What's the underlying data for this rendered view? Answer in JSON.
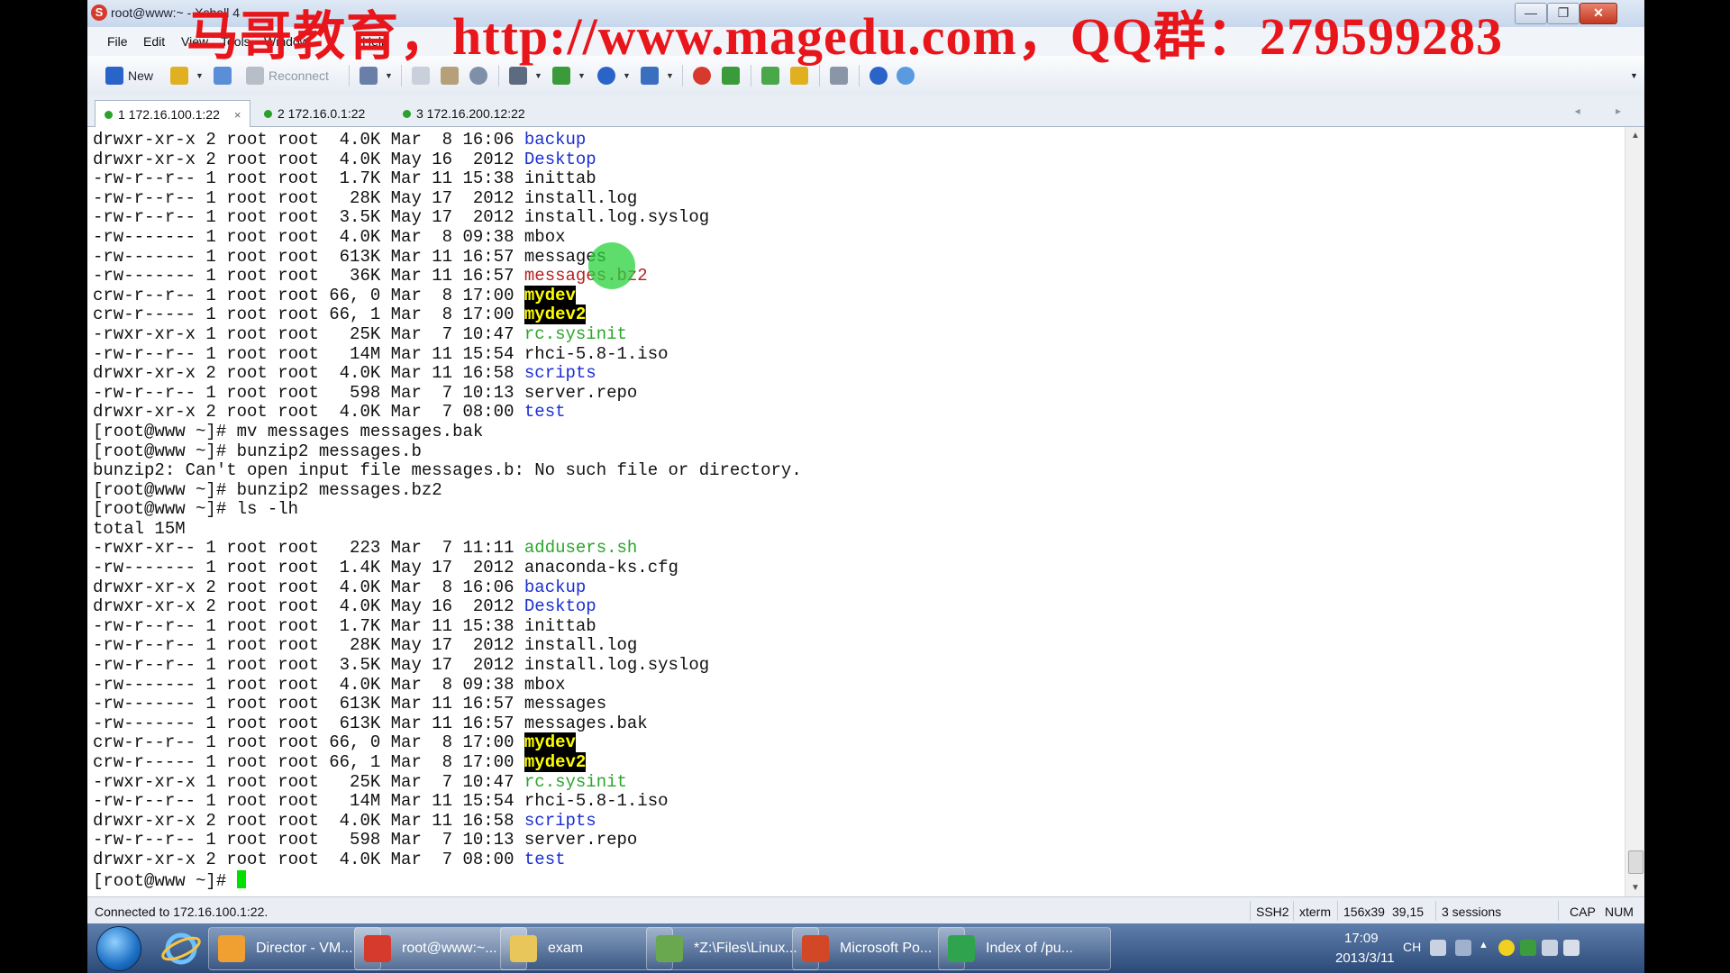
{
  "window": {
    "title": "root@www:~ - Xshell 4",
    "app_logo": "S",
    "controls": {
      "minimize": "—",
      "maximize": "❐",
      "close": "✕"
    }
  },
  "watermark": "马哥教育，http://www.magedu.com，QQ群：279599283",
  "menu": [
    "File",
    "Edit",
    "View",
    "Tools",
    "Window",
    "Help"
  ],
  "toolbar": {
    "new_label": "New",
    "reconnect_label": "Reconnect",
    "icons": [
      "new-session-icon",
      "open-folder-icon",
      "link-icon",
      "reconnect-icon",
      "properties-icon",
      "copy-icon",
      "paste-icon",
      "find-icon",
      "print-icon",
      "transfer-icon",
      "globe-icon",
      "font-icon",
      "xftp-icon",
      "script-icon",
      "layout-icon",
      "lock-icon",
      "keyboard-icon",
      "help-icon",
      "chat-icon"
    ],
    "colors": {
      "red": "#d63a2c",
      "green": "#3b9b3b",
      "blue": "#2a64c8",
      "yellow": "#e0b020",
      "gray": "#8a96a8"
    }
  },
  "tabs": [
    {
      "label": "1 172.16.100.1:22",
      "active": true,
      "close": "×"
    },
    {
      "label": "2 172.16.0.1:22",
      "active": false
    },
    {
      "label": "3 172.16.200.12:22",
      "active": false
    }
  ],
  "tab_arrows": "◂ ▸",
  "terminal": {
    "lines": [
      {
        "text": "drwxr-xr-x 2 root root  4.0K Mar  8 16:06 ",
        "name": "backup",
        "color": "blue"
      },
      {
        "text": "drwxr-xr-x 2 root root  4.0K May 16  2012 ",
        "name": "Desktop",
        "color": "blue"
      },
      {
        "text": "-rw-r--r-- 1 root root  1.7K Mar 11 15:38 ",
        "name": "inittab",
        "color": ""
      },
      {
        "text": "-rw-r--r-- 1 root root   28K May 17  2012 ",
        "name": "install.log",
        "color": ""
      },
      {
        "text": "-rw-r--r-- 1 root root  3.5K May 17  2012 ",
        "name": "install.log.syslog",
        "color": ""
      },
      {
        "text": "-rw------- 1 root root  4.0K Mar  8 09:38 ",
        "name": "mbox",
        "color": ""
      },
      {
        "text": "-rw------- 1 root root  613K Mar 11 16:57 ",
        "name": "messages",
        "color": ""
      },
      {
        "text": "-rw------- 1 root root   36K Mar 11 16:57 ",
        "name": "messages.bz2",
        "color": "red"
      },
      {
        "text": "crw-r--r-- 1 root root 66, 0 Mar  8 17:00 ",
        "name": "mydev",
        "color": "dev"
      },
      {
        "text": "crw-r----- 1 root root 66, 1 Mar  8 17:00 ",
        "name": "mydev2",
        "color": "dev"
      },
      {
        "text": "-rwxr-xr-x 1 root root   25K Mar  7 10:47 ",
        "name": "rc.sysinit",
        "color": "green"
      },
      {
        "text": "-rw-r--r-- 1 root root   14M Mar 11 15:54 ",
        "name": "rhci-5.8-1.iso",
        "color": ""
      },
      {
        "text": "drwxr-xr-x 2 root root  4.0K Mar 11 16:58 ",
        "name": "scripts",
        "color": "blue"
      },
      {
        "text": "-rw-r--r-- 1 root root   598 Mar  7 10:13 ",
        "name": "server.repo",
        "color": ""
      },
      {
        "text": "drwxr-xr-x 2 root root  4.0K Mar  7 08:00 ",
        "name": "test",
        "color": "blue"
      },
      {
        "text": "[root@www ~]# mv messages messages.bak",
        "name": "",
        "color": ""
      },
      {
        "text": "[root@www ~]# bunzip2 messages.b",
        "name": "",
        "color": ""
      },
      {
        "text": "bunzip2: Can't open input file messages.b: No such file or directory.",
        "name": "",
        "color": ""
      },
      {
        "text": "[root@www ~]# bunzip2 messages.bz2",
        "name": "",
        "color": ""
      },
      {
        "text": "[root@www ~]# ls -lh",
        "name": "",
        "color": ""
      },
      {
        "text": "total 15M",
        "name": "",
        "color": ""
      },
      {
        "text": "-rwxr-xr-- 1 root root   223 Mar  7 11:11 ",
        "name": "addusers.sh",
        "color": "green"
      },
      {
        "text": "-rw------- 1 root root  1.4K May 17  2012 ",
        "name": "anaconda-ks.cfg",
        "color": ""
      },
      {
        "text": "drwxr-xr-x 2 root root  4.0K Mar  8 16:06 ",
        "name": "backup",
        "color": "blue"
      },
      {
        "text": "drwxr-xr-x 2 root root  4.0K May 16  2012 ",
        "name": "Desktop",
        "color": "blue"
      },
      {
        "text": "-rw-r--r-- 1 root root  1.7K Mar 11 15:38 ",
        "name": "inittab",
        "color": ""
      },
      {
        "text": "-rw-r--r-- 1 root root   28K May 17  2012 ",
        "name": "install.log",
        "color": ""
      },
      {
        "text": "-rw-r--r-- 1 root root  3.5K May 17  2012 ",
        "name": "install.log.syslog",
        "color": ""
      },
      {
        "text": "-rw------- 1 root root  4.0K Mar  8 09:38 ",
        "name": "mbox",
        "color": ""
      },
      {
        "text": "-rw------- 1 root root  613K Mar 11 16:57 ",
        "name": "messages",
        "color": ""
      },
      {
        "text": "-rw------- 1 root root  613K Mar 11 16:57 ",
        "name": "messages.bak",
        "color": ""
      },
      {
        "text": "crw-r--r-- 1 root root 66, 0 Mar  8 17:00 ",
        "name": "mydev",
        "color": "dev"
      },
      {
        "text": "crw-r----- 1 root root 66, 1 Mar  8 17:00 ",
        "name": "mydev2",
        "color": "dev"
      },
      {
        "text": "-rwxr-xr-x 1 root root   25K Mar  7 10:47 ",
        "name": "rc.sysinit",
        "color": "green"
      },
      {
        "text": "-rw-r--r-- 1 root root   14M Mar 11 15:54 ",
        "name": "rhci-5.8-1.iso",
        "color": ""
      },
      {
        "text": "drwxr-xr-x 2 root root  4.0K Mar 11 16:58 ",
        "name": "scripts",
        "color": "blue"
      },
      {
        "text": "-rw-r--r-- 1 root root   598 Mar  7 10:13 ",
        "name": "server.repo",
        "color": ""
      },
      {
        "text": "drwxr-xr-x 2 root root  4.0K Mar  7 08:00 ",
        "name": "test",
        "color": "blue"
      }
    ],
    "prompt": "[root@www ~]# "
  },
  "scrollbar": {
    "up": "▲",
    "down": "▼"
  },
  "status": {
    "connection": "Connected to 172.16.100.1:22.",
    "protocol": "SSH2",
    "terminal_type": "xterm",
    "size": "156x39",
    "cursor_pos": "39,15",
    "sessions": "3 sessions",
    "caps": "CAP",
    "num": "NUM"
  },
  "taskbar": {
    "tasks": [
      {
        "label": "Director - VM...",
        "icon": "vmware-icon",
        "color": "#f0a030"
      },
      {
        "label": "root@www:~...",
        "icon": "xshell-icon",
        "color": "#d63a2c",
        "active": true
      },
      {
        "label": "exam",
        "icon": "folder-icon",
        "color": "#e8c65a"
      },
      {
        "label": "*Z:\\Files\\Linux...",
        "icon": "editor-icon",
        "color": "#6aa84f"
      },
      {
        "label": "Microsoft Po...",
        "icon": "powerpoint-icon",
        "color": "#d24726"
      },
      {
        "label": "Index of /pu...",
        "icon": "chrome-icon",
        "color": "#2fa34d"
      }
    ],
    "lang": "CH",
    "time": "17:09",
    "date": "2013/3/11"
  }
}
